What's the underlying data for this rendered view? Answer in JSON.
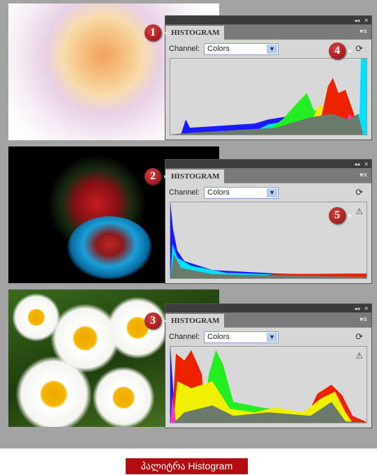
{
  "panels": [
    {
      "title": "HISTOGRAM",
      "channel_label": "Channel:",
      "channel_value": "Colors",
      "badge": "1",
      "refresh_badge": "4"
    },
    {
      "title": "HISTOGRAM",
      "channel_label": "Channel:",
      "channel_value": "Colors",
      "badge": "2",
      "warning_badge": "5"
    },
    {
      "title": "HISTOGRAM",
      "channel_label": "Channel:",
      "channel_value": "Colors",
      "badge": "3"
    }
  ],
  "icons": {
    "collapse": "◂◂",
    "close": "✕",
    "menu": "▾≡",
    "refresh": "⟳",
    "warning": "⚠",
    "dropdown": "▼"
  },
  "caption": "პალიტრა Histogram",
  "colors": {
    "badge": "#b01015",
    "caption_bg": "#b20c10",
    "panel_bg": "#d6d6d6"
  }
}
